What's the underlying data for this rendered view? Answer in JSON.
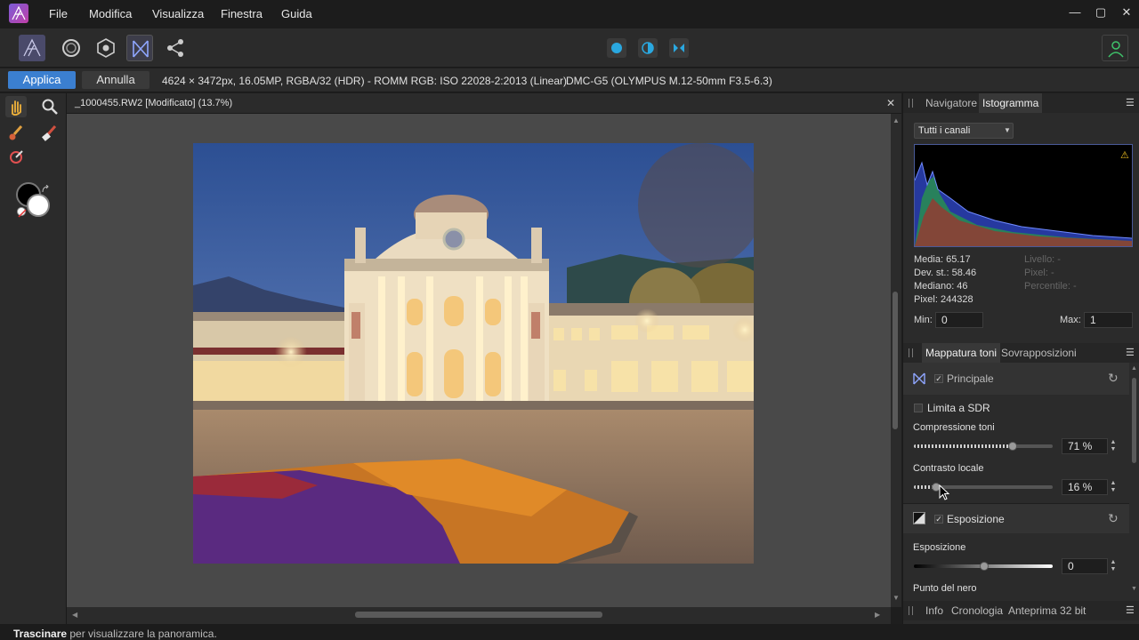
{
  "menu": [
    "File",
    "Modifica",
    "Visualizza",
    "Finestra",
    "Guida"
  ],
  "window_controls": {
    "minimize": "—",
    "maximize": "▢",
    "close": "✕"
  },
  "context": {
    "apply_label": "Applica",
    "cancel_label": "Annulla",
    "image_info": "4624 × 3472px, 16.05MP, RGBA/32 (HDR) - ROMM RGB: ISO 22028-2:2013 (Linear)",
    "camera_info": "DMC-G5 (OLYMPUS M.12-50mm F3.5-6.3)"
  },
  "document": {
    "tab_title": "_1000455.RW2 [Modificato] (13.7%)",
    "close": "✕"
  },
  "status": {
    "bold": "Trascinare",
    "rest": " per visualizzare la panoramica."
  },
  "histogram_panel": {
    "tabs": [
      "Navigatore",
      "Istogramma"
    ],
    "active_tab": "Istogramma",
    "channel_select": "Tutti i canali",
    "stats_left": [
      "Media: 65.17",
      "Dev. st.: 58.46",
      "Mediano: 46",
      "Pixel: 244328"
    ],
    "stats_right": [
      "Livello: -",
      "Pixel: -",
      "Percentile: -"
    ],
    "min_label": "Min:",
    "min_value": "0",
    "max_label": "Max:",
    "max_value": "1"
  },
  "tonemap_panel": {
    "tabs": [
      "Mappatura toni",
      "Sovrapposizioni"
    ],
    "active_tab": "Mappatura toni",
    "principale_label": "Principale",
    "limit_sdr_label": "Limita a SDR",
    "compression_label": "Compressione toni",
    "compression_value": "71 %",
    "compression_level": 0.71,
    "local_contrast_label": "Contrasto locale",
    "local_contrast_value": "16 %",
    "local_contrast_level": 0.16,
    "exposure_section_label": "Esposizione",
    "exposure_label": "Esposizione",
    "exposure_value": "0",
    "black_point_label": "Punto del nero"
  },
  "bottom_tabs": [
    "Info",
    "Cronologia",
    "Anteprima 32 bit"
  ],
  "colors": {
    "accent": "#3b7fd0",
    "bg_dark": "#1c1c1c",
    "panel": "#2b2b2b",
    "canvas": "#494949"
  }
}
